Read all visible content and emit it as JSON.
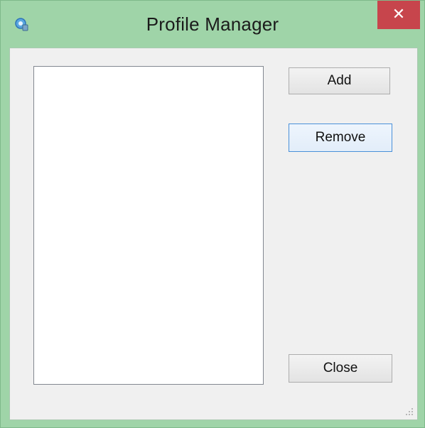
{
  "window": {
    "title": "Profile Manager",
    "close_glyph": "✕",
    "icon": "app-gear-icon"
  },
  "profiles": {
    "items": []
  },
  "buttons": {
    "add_label": "Add",
    "remove_label": "Remove",
    "close_label": "Close"
  },
  "colors": {
    "titlebar": "#9fd4a8",
    "close_button": "#c7454c",
    "client_area": "#f0f0f0",
    "focus_border": "#4a90d9"
  }
}
